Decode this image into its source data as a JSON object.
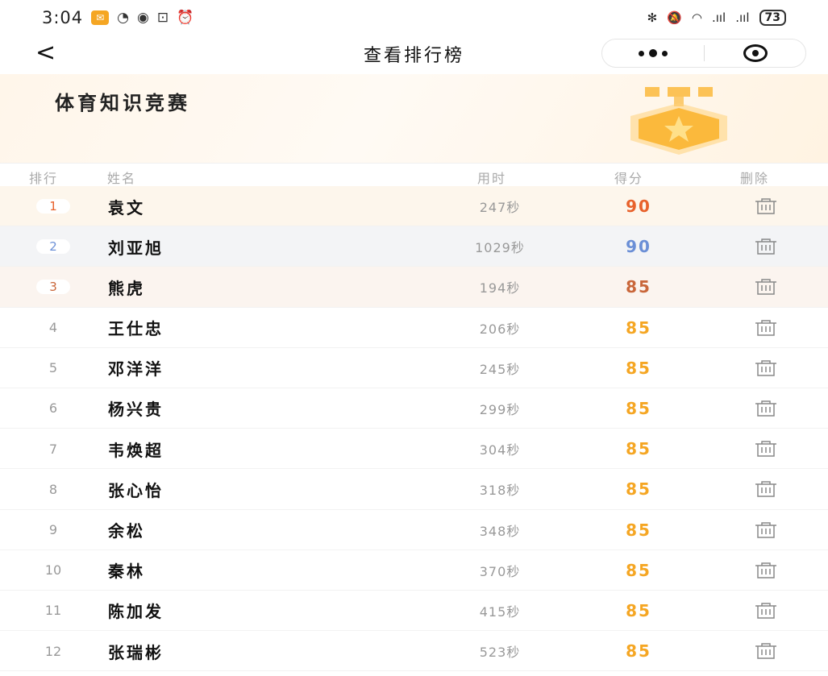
{
  "status_bar": {
    "time": "3:04",
    "battery": "73",
    "signal_1": ".ııl",
    "signal_2": ".ııl"
  },
  "nav": {
    "back_glyph": "<",
    "title": "查看排行榜"
  },
  "banner": {
    "title": "体育知识竞赛"
  },
  "table": {
    "headers": {
      "rank": "排行",
      "name": "姓名",
      "time": "用时",
      "score": "得分",
      "delete": "删除"
    },
    "rows": [
      {
        "rank": "1",
        "name": "袁文",
        "time": "247秒",
        "score": "90"
      },
      {
        "rank": "2",
        "name": "刘亚旭",
        "time": "1029秒",
        "score": "90"
      },
      {
        "rank": "3",
        "name": "熊虎",
        "time": "194秒",
        "score": "85"
      },
      {
        "rank": "4",
        "name": "王仕忠",
        "time": "206秒",
        "score": "85"
      },
      {
        "rank": "5",
        "name": "邓洋洋",
        "time": "245秒",
        "score": "85"
      },
      {
        "rank": "6",
        "name": "杨兴贵",
        "time": "299秒",
        "score": "85"
      },
      {
        "rank": "7",
        "name": "韦焕超",
        "time": "304秒",
        "score": "85"
      },
      {
        "rank": "8",
        "name": "张心怡",
        "time": "318秒",
        "score": "85"
      },
      {
        "rank": "9",
        "name": "余松",
        "time": "348秒",
        "score": "85"
      },
      {
        "rank": "10",
        "name": "秦林",
        "time": "370秒",
        "score": "85"
      },
      {
        "rank": "11",
        "name": "陈加发",
        "time": "415秒",
        "score": "85"
      },
      {
        "rank": "12",
        "name": "张瑞彬",
        "time": "523秒",
        "score": "85"
      }
    ]
  },
  "colors": {
    "rank1": "#e8622c",
    "rank2": "#6b8fd6",
    "rank3": "#c9663a",
    "score_default": "#f5a623",
    "medal": "#fbb93c"
  },
  "icons": {
    "delete": "trash-icon",
    "medal": "medal-icon",
    "back": "chevron-left-icon"
  }
}
